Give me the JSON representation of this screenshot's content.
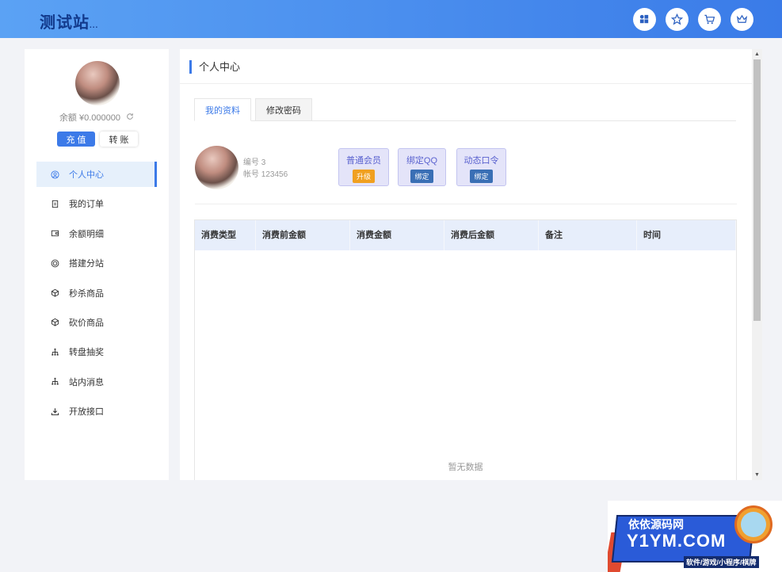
{
  "header": {
    "logo": "测试站",
    "logo_suffix": "..."
  },
  "sidebar": {
    "balance": "余额 ¥0.000000",
    "recharge_label": "充 值",
    "transfer_label": "转 账",
    "items": [
      {
        "label": "个人中心",
        "icon": "user-circle-icon"
      },
      {
        "label": "我的订单",
        "icon": "order-icon"
      },
      {
        "label": "余额明细",
        "icon": "wallet-icon"
      },
      {
        "label": "搭建分站",
        "icon": "site-icon"
      },
      {
        "label": "秒杀商品",
        "icon": "box-icon"
      },
      {
        "label": "砍价商品",
        "icon": "box-icon"
      },
      {
        "label": "转盘抽奖",
        "icon": "sitemap-icon"
      },
      {
        "label": "站内消息",
        "icon": "sitemap-icon"
      },
      {
        "label": "开放接口",
        "icon": "download-icon"
      }
    ]
  },
  "main": {
    "title": "个人中心",
    "tabs": [
      {
        "label": "我的资料"
      },
      {
        "label": "修改密码"
      }
    ],
    "profile": {
      "id_line": "编号 3",
      "account_line": "帐号 123456"
    },
    "badges": [
      {
        "title": "普通会员",
        "action": "升级",
        "color": "#f0a020"
      },
      {
        "title": "绑定QQ",
        "action": "绑定",
        "color": "#3a6fb5"
      },
      {
        "title": "动态口令",
        "action": "绑定",
        "color": "#3a6fb5"
      }
    ],
    "table": {
      "columns": [
        "消费类型",
        "消费前金额",
        "消费金额",
        "消费后金额",
        "备注",
        "时间"
      ],
      "rows": [],
      "empty_text": "暂无数据"
    }
  },
  "watermark": {
    "line1": "依依源码网",
    "line2": "Y1YM.COM",
    "line3": "软件/游戏/小程序/棋牌"
  }
}
